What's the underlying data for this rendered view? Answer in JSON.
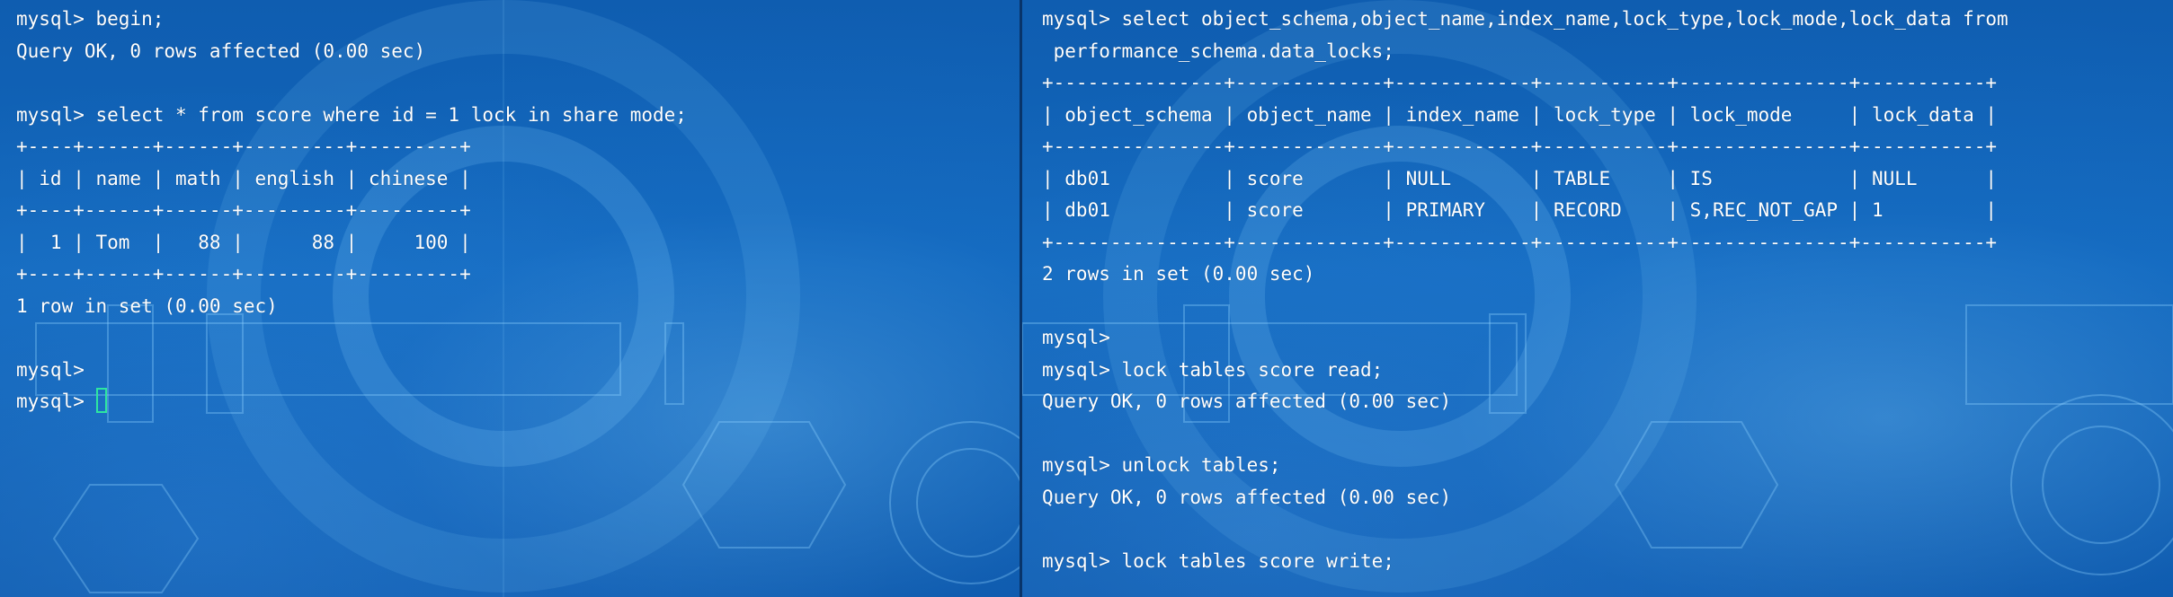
{
  "left_terminal": {
    "lines": [
      "mysql> begin;",
      "Query OK, 0 rows affected (0.00 sec)",
      "",
      "mysql> select * from score where id = 1 lock in share mode;",
      "+----+------+------+---------+---------+",
      "| id | name | math | english | chinese |",
      "+----+------+------+---------+---------+",
      "|  1 | Tom  |   88 |      88 |     100 |",
      "+----+------+------+---------+---------+",
      "1 row in set (0.00 sec)",
      "",
      "mysql>",
      "mysql> "
    ]
  },
  "right_terminal": {
    "lines": [
      "mysql> select object_schema,object_name,index_name,lock_type,lock_mode,lock_data from",
      " performance_schema.data_locks;",
      "+---------------+-------------+------------+-----------+---------------+-----------+",
      "| object_schema | object_name | index_name | lock_type | lock_mode     | lock_data |",
      "+---------------+-------------+------------+-----------+---------------+-----------+",
      "| db01          | score       | NULL       | TABLE     | IS            | NULL      |",
      "| db01          | score       | PRIMARY    | RECORD    | S,REC_NOT_GAP | 1         |",
      "+---------------+-------------+------------+-----------+---------------+-----------+",
      "2 rows in set (0.00 sec)",
      "",
      "mysql>",
      "mysql> lock tables score read;",
      "Query OK, 0 rows affected (0.00 sec)",
      "",
      "mysql> unlock tables;",
      "Query OK, 0 rows affected (0.00 sec)",
      "",
      "mysql> lock tables score write;"
    ]
  },
  "colors": {
    "background": "#1268bd",
    "text": "#ffffff",
    "cursor": "#2ee6a0",
    "divider": "#08346a"
  }
}
